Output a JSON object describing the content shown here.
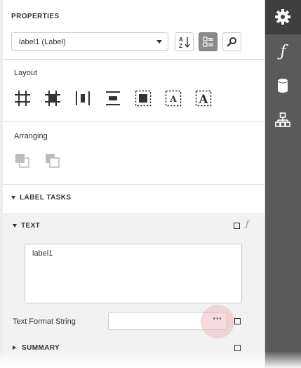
{
  "properties": {
    "title": "PROPERTIES",
    "selected_component": "label1 (Label)",
    "toolbar": {
      "sort_icon": "sort-alpha-icon",
      "categories_icon": "categories-icon",
      "search_icon": "search-icon"
    }
  },
  "layout": {
    "title": "Layout",
    "icons": [
      "align-to-grid-icon",
      "size-to-grid-icon",
      "center-horizontally-icon",
      "center-vertically-icon",
      "fit-bounds-to-container-icon",
      "fit-text-to-bounds-icon",
      "fit-bounds-to-text-icon"
    ]
  },
  "arranging": {
    "title": "Arranging",
    "icons": [
      "bring-to-front-icon",
      "send-to-back-icon"
    ]
  },
  "tasks": {
    "title": "LABEL TASKS",
    "text_section": {
      "title": "TEXT",
      "value": "label1",
      "expression_icon": "ƒ"
    },
    "format_string": {
      "label": "Text Format String",
      "value": "",
      "ellipsis": "···"
    },
    "summary_section": {
      "title": "SUMMARY"
    }
  },
  "rail": {
    "items": [
      "gear-icon",
      "expressions-icon",
      "database-icon",
      "report-explorer-icon"
    ],
    "expressions_glyph": "ƒ"
  },
  "colors": {
    "rail_background": "#5a5a5a",
    "rail_active": "#3f3f3f",
    "highlight_halo": "#ecb0b4"
  }
}
